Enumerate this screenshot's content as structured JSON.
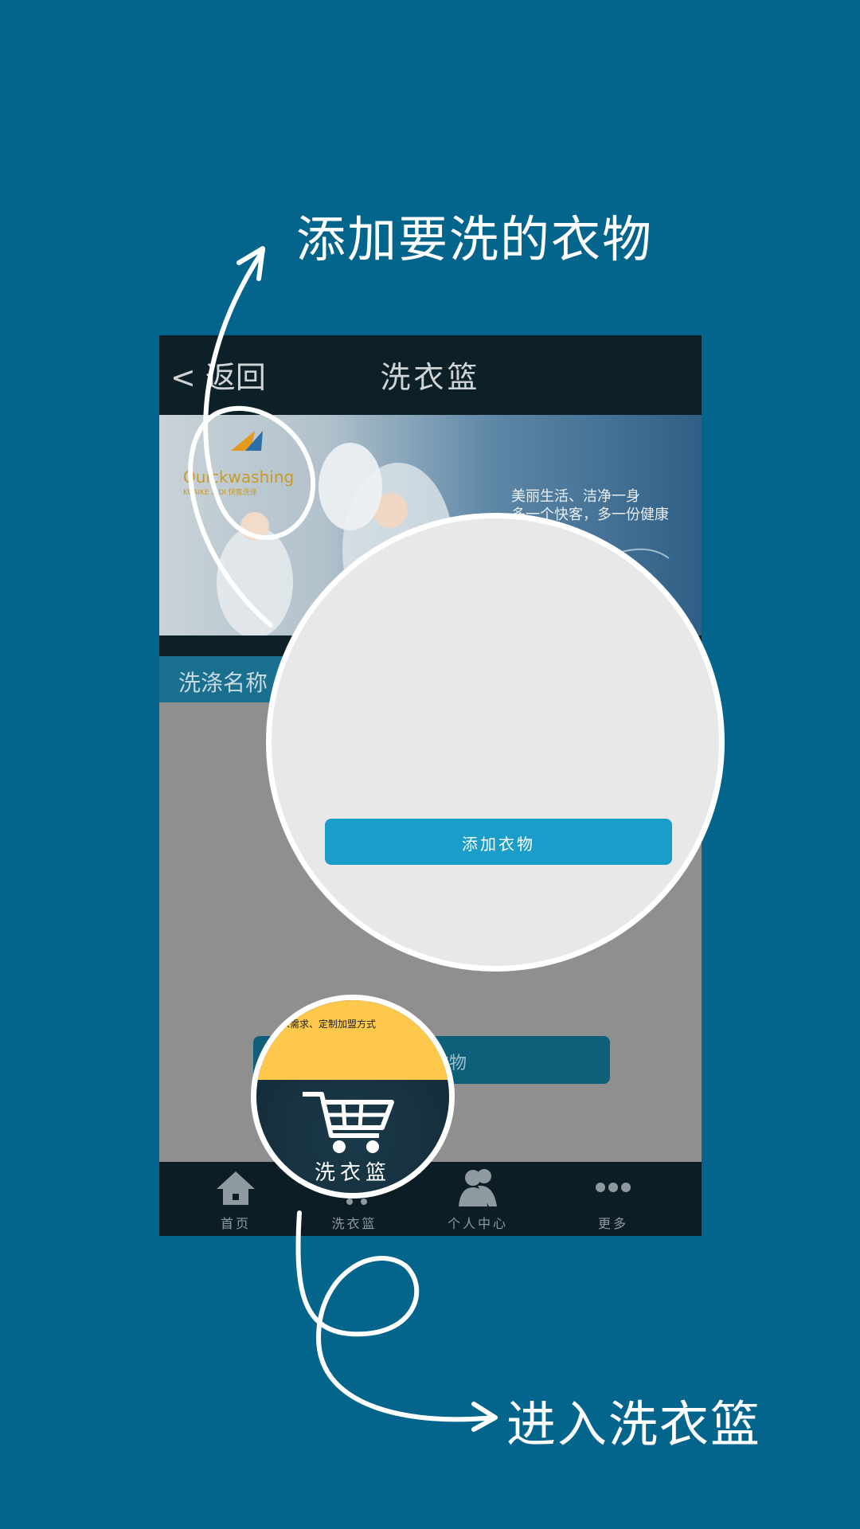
{
  "captions": {
    "top": "添加要洗的衣物",
    "bottom": "进入洗衣篮"
  },
  "appbar": {
    "back_label": "< 返回",
    "title": "洗衣篮"
  },
  "banner": {
    "slogan_line1": "美丽生活、洁净一身",
    "slogan_line2": "多一个快客，多一份健康",
    "brand_en": "Quickwashing",
    "brand_sub": "KUAIKE XIDI 快客洗涤"
  },
  "section": {
    "label": "洗涤名称"
  },
  "background_button": {
    "label": "添加衣物"
  },
  "zoom": {
    "button_label": "添加衣物",
    "cart_label": "洗衣篮",
    "promo_text": "求需求、定制加盟方式"
  },
  "tabs": [
    {
      "label": "首页",
      "icon": "home-icon"
    },
    {
      "label": "洗衣篮",
      "icon": "cart-icon"
    },
    {
      "label": "个人中心",
      "icon": "user-icon"
    },
    {
      "label": "更多",
      "icon": "more-icon"
    }
  ],
  "colors": {
    "background": "#03648c",
    "appbar": "#0d2028",
    "accent": "#1a9dc8",
    "promo": "#fdc84c"
  }
}
